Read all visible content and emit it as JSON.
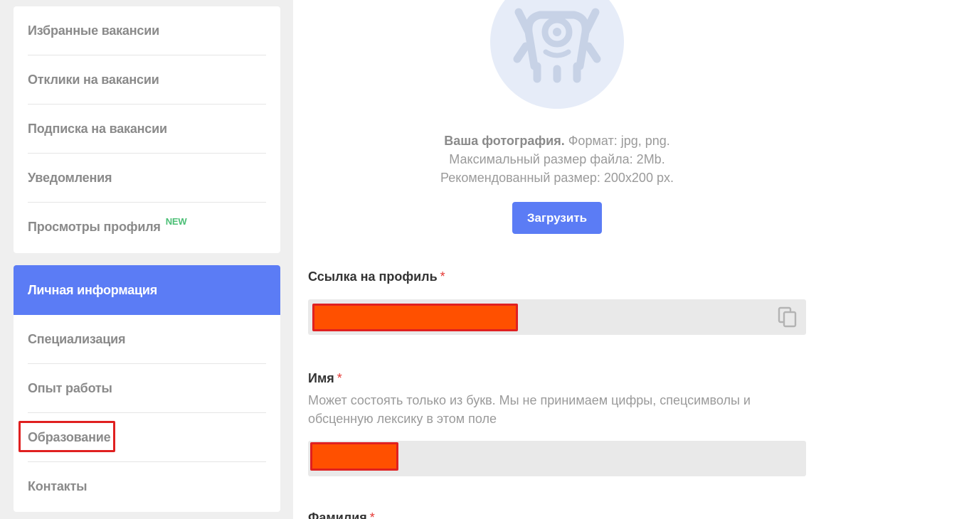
{
  "sidebar": {
    "top_items": [
      {
        "label": "Избранные вакансии"
      },
      {
        "label": "Отклики на вакансии"
      },
      {
        "label": "Подписка на вакансии"
      },
      {
        "label": "Уведомления"
      },
      {
        "label": "Просмотры профиля",
        "badge": "NEW"
      }
    ],
    "bottom_items": [
      {
        "label": "Личная информация",
        "active": true
      },
      {
        "label": "Специализация"
      },
      {
        "label": "Опыт работы"
      },
      {
        "label": "Образование"
      },
      {
        "label": "Контакты"
      }
    ]
  },
  "photo": {
    "title": "Ваша фотография.",
    "format": "Формат: jpg, png.",
    "max_size": "Максимальный размер файла: 2Mb.",
    "recommended": "Рекомендованный размер: 200x200 px.",
    "upload_label": "Загрузить"
  },
  "form": {
    "profile_link": {
      "label": "Ссылка на профиль",
      "required_mark": "*"
    },
    "first_name": {
      "label": "Имя",
      "required_mark": "*",
      "hint": "Может состоять только из букв. Мы не принимаем цифры, спецсимволы и обсценную лексику в этом поле"
    },
    "last_name": {
      "label": "Фамилия",
      "required_mark": "*"
    }
  },
  "colors": {
    "accent": "#5b7cf5",
    "new_badge": "#4cbf76",
    "required": "#e53935",
    "redaction": "#ff5000",
    "highlight": "#e02020"
  }
}
